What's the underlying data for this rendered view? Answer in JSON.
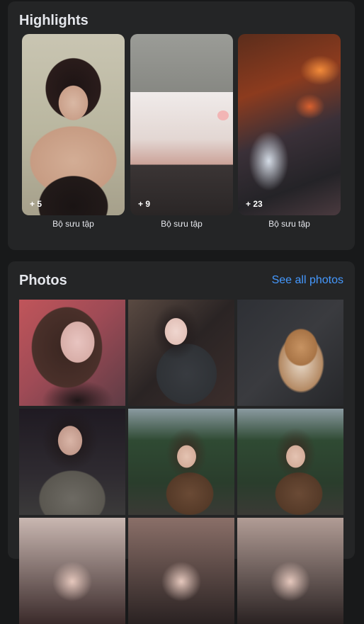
{
  "highlights": {
    "title": "Highlights",
    "items": [
      {
        "count": "+ 5",
        "label": "Bộ sưu tập"
      },
      {
        "count": "+ 9",
        "label": "Bộ sưu tập"
      },
      {
        "count": "+ 23",
        "label": "Bộ sưu tập"
      }
    ]
  },
  "photos": {
    "title": "Photos",
    "see_all": "See all photos",
    "count": 9
  },
  "colors": {
    "page_bg": "#18191a",
    "card_bg": "#242526",
    "text": "#e4e6eb",
    "link": "#4599ff"
  }
}
